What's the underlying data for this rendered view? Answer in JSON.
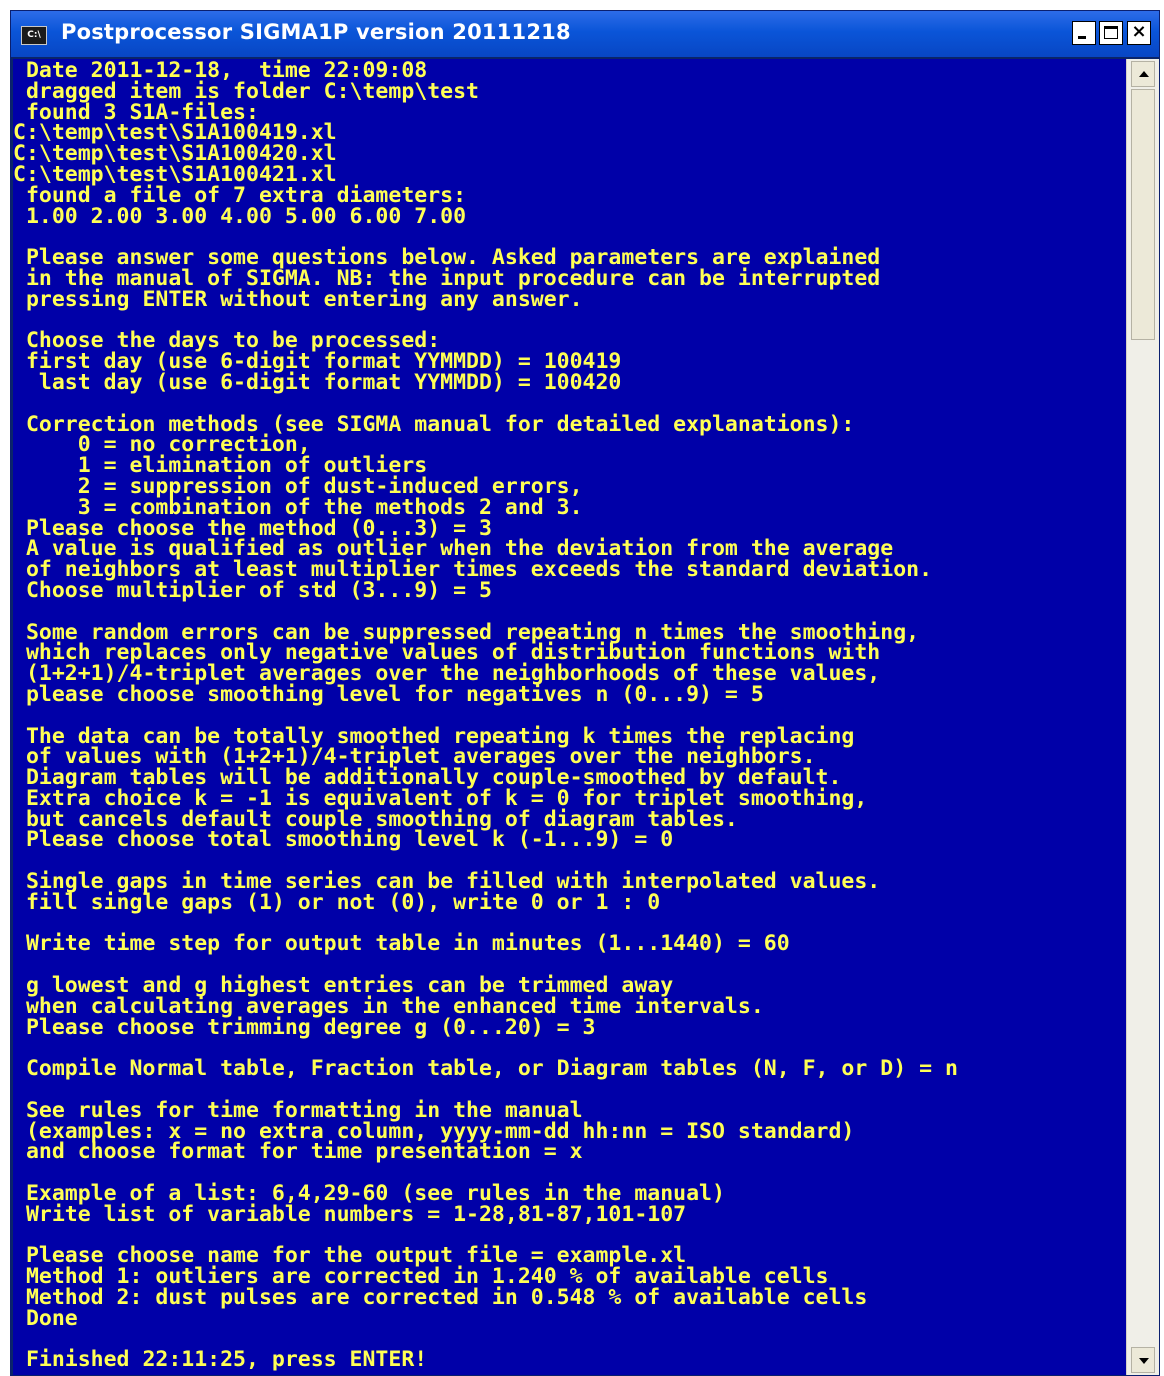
{
  "window": {
    "icon_label": "C:\\",
    "title": "Postprocessor SIGMA1P version 20111218",
    "controls": {
      "minimize": "minimize",
      "maximize": "maximize",
      "close": "×"
    }
  },
  "colors": {
    "console_background": "#0000a8",
    "console_text": "#ffff55",
    "titlebar": "#0a55d8"
  },
  "console": {
    "lines": [
      " Date 2011-12-18,  time 22:09:08",
      " dragged item is folder C:\\temp\\test",
      " found 3 S1A-files:",
      "C:\\temp\\test\\S1A100419.xl",
      "C:\\temp\\test\\S1A100420.xl",
      "C:\\temp\\test\\S1A100421.xl",
      " found a file of 7 extra diameters:",
      " 1.00 2.00 3.00 4.00 5.00 6.00 7.00",
      "",
      " Please answer some questions below. Asked parameters are explained",
      " in the manual of SIGMA. NB: the input procedure can be interrupted",
      " pressing ENTER without entering any answer.",
      "",
      " Choose the days to be processed:",
      " first day (use 6-digit format YYMMDD) = 100419",
      "  last day (use 6-digit format YYMMDD) = 100420",
      "",
      " Correction methods (see SIGMA manual for detailed explanations):",
      "     0 = no correction,",
      "     1 = elimination of outliers",
      "     2 = suppression of dust-induced errors,",
      "     3 = combination of the methods 2 and 3.",
      " Please choose the method (0...3) = 3",
      " A value is qualified as outlier when the deviation from the average",
      " of neighbors at least multiplier times exceeds the standard deviation.",
      " Choose multiplier of std (3...9) = 5",
      "",
      " Some random errors can be suppressed repeating n times the smoothing,",
      " which replaces only negative values of distribution functions with",
      " (1+2+1)/4-triplet averages over the neighborhoods of these values,",
      " please choose smoothing level for negatives n (0...9) = 5",
      "",
      " The data can be totally smoothed repeating k times the replacing",
      " of values with (1+2+1)/4-triplet averages over the neighbors.",
      " Diagram tables will be additionally couple-smoothed by default.",
      " Extra choice k = -1 is equivalent of k = 0 for triplet smoothing,",
      " but cancels default couple smoothing of diagram tables.",
      " Please choose total smoothing level k (-1...9) = 0",
      "",
      " Single gaps in time series can be filled with interpolated values.",
      " fill single gaps (1) or not (0), write 0 or 1 : 0",
      "",
      " Write time step for output table in minutes (1...1440) = 60",
      "",
      " g lowest and g highest entries can be trimmed away",
      " when calculating averages in the enhanced time intervals.",
      " Please choose trimming degree g (0...20) = 3",
      "",
      " Compile Normal table, Fraction table, or Diagram tables (N, F, or D) = n",
      "",
      " See rules for time formatting in the manual",
      " (examples: x = no extra column, yyyy-mm-dd hh:nn = ISO standard)",
      " and choose format for time presentation = x",
      "",
      " Example of a list: 6,4,29-60 (see rules in the manual)",
      " Write list of variable numbers = 1-28,81-87,101-107",
      "",
      " Please choose name for the output file = example.xl",
      " Method 1: outliers are corrected in 1.240 % of available cells",
      " Method 2: dust pulses are corrected in 0.548 % of available cells",
      " Done",
      "",
      " Finished 22:11:25, press ENTER!"
    ]
  },
  "scrollbar": {
    "position_fraction": 0.0,
    "visible_fraction": 0.2
  }
}
